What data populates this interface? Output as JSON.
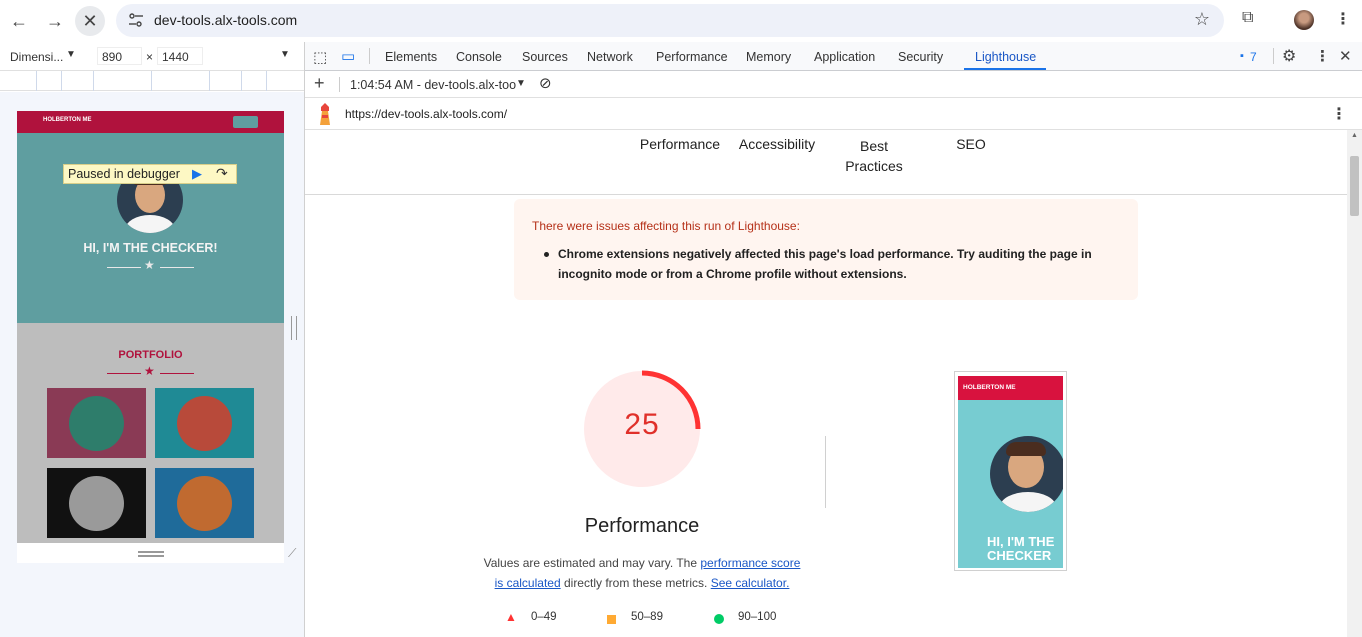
{
  "browser": {
    "url": "dev-tools.alx-tools.com",
    "nav": [
      "back-icon",
      "forward-icon",
      "stop-icon"
    ]
  },
  "device_toolbar": {
    "device": "Dimensi...",
    "width": "890",
    "times": "×",
    "height": "1440"
  },
  "device_preview": {
    "brand": "HOLBERTON ME",
    "paused_label": "Paused in debugger",
    "hero_title": "HI, I'M THE CHECKER!",
    "portfolio_title": "PORTFOLIO"
  },
  "devtools": {
    "tabs": [
      "Elements",
      "Console",
      "Sources",
      "Network",
      "Performance",
      "Memory",
      "Application",
      "Security",
      "Lighthouse"
    ],
    "active_tab": "Lighthouse",
    "issues_count": "7"
  },
  "lighthouse_toolbar": {
    "run_label": "1:04:54 AM - dev-tools.alx-too"
  },
  "lighthouse_urlbar": {
    "url": "https://dev-tools.alx-tools.com/"
  },
  "report": {
    "categories": [
      "Performance",
      "Accessibility",
      "Best",
      "Practices",
      "SEO"
    ],
    "warning": {
      "title": "There were issues affecting this run of Lighthouse:",
      "items": [
        "Chrome extensions negatively affected this page's load performance. Try auditing the page in incognito mode or from a Chrome profile without extensions."
      ]
    },
    "score": {
      "value": 25,
      "display": "25",
      "title": "Performance",
      "desc_pre": "Values are estimated and may vary. The ",
      "desc_link1a": "performance score",
      "desc_link1b": "is calculated",
      "desc_mid": " directly from these metrics. ",
      "desc_link2": "See calculator.",
      "color": "#ff3333"
    },
    "legend": [
      {
        "label": "0–49",
        "color": "#ff3333",
        "shape": "triangle"
      },
      {
        "label": "50–89",
        "color": "#ffaa33",
        "shape": "square"
      },
      {
        "label": "90–100",
        "color": "#00cc66",
        "shape": "circle"
      }
    ],
    "thumbnail": {
      "brand": "HOLBERTON ME",
      "hero_line1": "HI, I'M THE",
      "hero_line2": "CHECKER"
    }
  }
}
